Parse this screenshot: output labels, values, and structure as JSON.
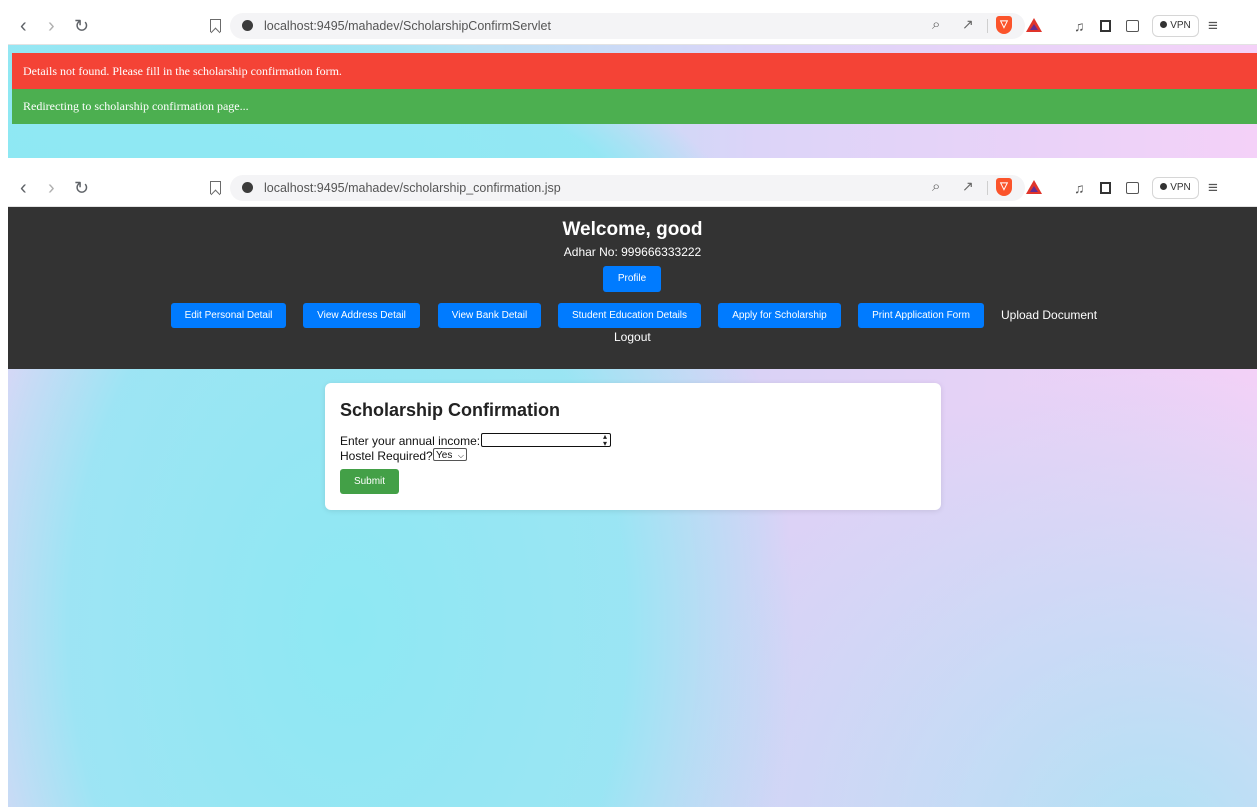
{
  "top_window": {
    "url": "localhost:9495/mahadev/ScholarshipConfirmServlet",
    "alerts": {
      "error": "Details not found. Please fill in the scholarship confirmation form.",
      "success": "Redirecting to scholarship confirmation page..."
    }
  },
  "bottom_window": {
    "url": "localhost:9495/mahadev/scholarship_confirmation.jsp",
    "header": {
      "welcome": "Welcome, good",
      "adhar": "Adhar No: 999666333222",
      "profile_label": "Profile",
      "nav_buttons": [
        "Edit Personal Detail",
        "View Address Detail",
        "View Bank Detail",
        "Student Education Details",
        "Apply for Scholarship",
        "Print Application Form"
      ],
      "upload_label": "Upload Document",
      "logout_label": "Logout"
    },
    "form": {
      "title": "Scholarship Confirmation",
      "income_label": "Enter your annual income:",
      "income_value": "",
      "hostel_label": "Hostel Required?",
      "hostel_selected": "Yes",
      "submit_label": "Submit"
    }
  },
  "browser": {
    "vpn_label": "VPN"
  },
  "colors": {
    "error": "#f44336",
    "success": "#4caf50",
    "header_bg": "#333333",
    "nav_button": "#007bff",
    "submit_button": "#43a047"
  },
  "icons": [
    "back-icon",
    "forward-icon",
    "reload-icon",
    "bookmark-icon",
    "site-info-icon",
    "zoom-icon",
    "share-icon",
    "brave-shields-icon",
    "brave-rewards-icon",
    "media-icon",
    "sidebar-icon",
    "wallet-icon",
    "vpn-icon",
    "menu-icon"
  ]
}
